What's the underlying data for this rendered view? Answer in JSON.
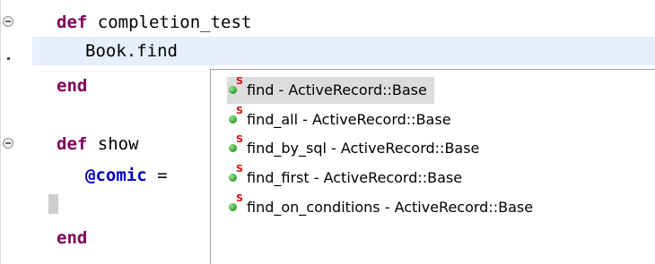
{
  "editor": {
    "lines": [
      {
        "keyword": "def",
        "text": " completion_test"
      },
      {
        "text": "Book.find"
      },
      {
        "keyword": "end"
      },
      {
        "keyword": "def",
        "text": " show"
      },
      {
        "ivar": "@comic",
        "text": " ="
      },
      {
        "text": ""
      },
      {
        "keyword": "end"
      }
    ]
  },
  "completion_popup": {
    "selected_index": 0,
    "items": [
      {
        "label": "find - ActiveRecord::Base",
        "icon": "singleton-method-icon"
      },
      {
        "label": "find_all - ActiveRecord::Base",
        "icon": "singleton-method-icon"
      },
      {
        "label": "find_by_sql - ActiveRecord::Base",
        "icon": "singleton-method-icon"
      },
      {
        "label": "find_first - ActiveRecord::Base",
        "icon": "singleton-method-icon"
      },
      {
        "label": "find_on_conditions - ActiveRecord::Base",
        "icon": "singleton-method-icon"
      }
    ],
    "icon_badge": "S"
  },
  "colors": {
    "keyword": "#7f0055",
    "instance_variable": "#0000c0",
    "current_line": "#e6effb",
    "selection": "#dcdcdc"
  }
}
